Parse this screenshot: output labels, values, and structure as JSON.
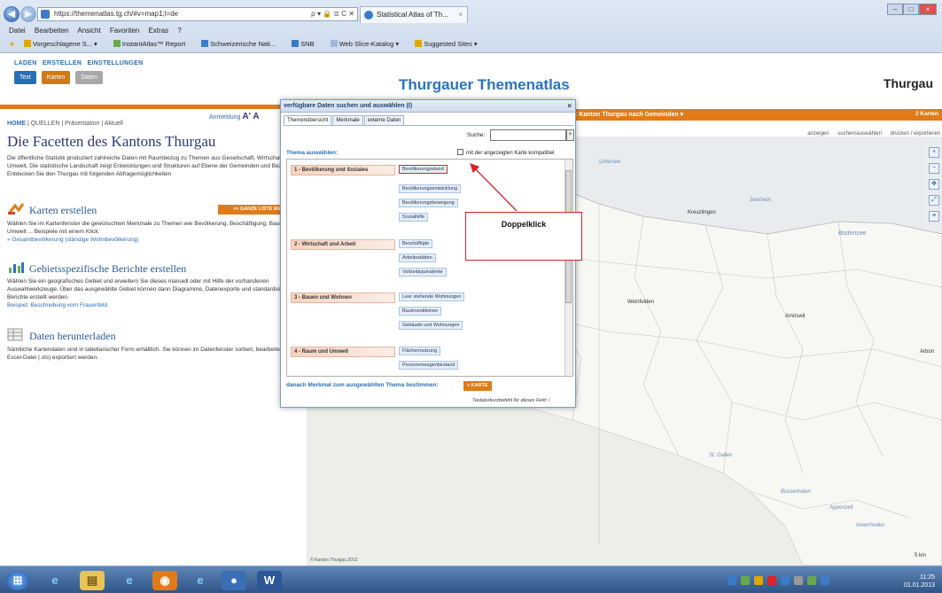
{
  "browser": {
    "url": "https://themenatlas.tg.ch/#v=map1;l=de",
    "address_tools": "ρ ▾ 🔒 ≣ C ✕",
    "tab_title": "Statistical Atlas of Th...",
    "menu": [
      "Datei",
      "Bearbeiten",
      "Ansicht",
      "Favoriten",
      "Extras",
      "?"
    ],
    "favorites": [
      "Vorgeschlagene S... ▾",
      "InstantAtlas™ Report",
      "Schweizerische Nati...",
      "SNB",
      "Web Slice-Katalog ▾",
      "Suggested Sites ▾"
    ]
  },
  "header": {
    "links": [
      "LADEN",
      "ERSTELLEN",
      "EINSTELLUNGEN"
    ],
    "mode_buttons": [
      "Text",
      "Karten",
      "Daten"
    ],
    "title": "Thurgauer Themenatlas",
    "brand": "Thurgau"
  },
  "left": {
    "login": "Anmeldung",
    "font_size": "A' A",
    "breadcrumb": [
      "HOME",
      "QUELLEN",
      "Präsentation",
      "Aktuell"
    ],
    "heading": "Die Facetten des Kantons Thurgau",
    "intro": "Die öffentliche Statistik produziert zahlreiche Daten mit Raumbezug zu Themen aus Gesellschaft, Wirtschaft und Umwelt. Die statistische Landschaft zeigt Entwicklungen und Strukturen auf Ebene der Gemeinden und Bezirke. Entdecken Sie den Thurgau mit folgenden Abfragemöglichkeiten",
    "sections": [
      {
        "title": "Karten erstellen",
        "text": "Wählen Sie im Kartenfenster die gewünschten Merkmale zu Themen wie Bevölkerung, Beschäftigung, Bauen, Umwelt ... Beispiele mit einem Klick:",
        "link": "» Gesamtbevölkerung (ständige Wohnbevölkerung)"
      },
      {
        "title": "Gebietsspezifische Berichte erstellen",
        "text": "Wählen Sie ein geografisches Gebiet und erweitern Sie dieses manuell oder mit Hilfe der vorhandenen Auswahlwerkzeuge. Über das ausgewählte Gebiet können dann Diagramme, Datenexporte und standardisierte Berichte erstellt werden.",
        "link": "Beispiel: Beschreibung vom Frauenfeld"
      },
      {
        "title": "Daten herunterladen",
        "text": "Sämtliche Kartendaten sind in tabellarischer Form erhältlich. Sie können im Datenfenster sortiert, bearbeitet und als Excel-Datei (.xls) exportiert werden.",
        "link": ""
      }
    ],
    "list_button": ">> GANZE LISTE MERK"
  },
  "map": {
    "title": ": Kanton Thurgau nach Gemeinden ▾",
    "right_label": "2 Karten",
    "toolbar": [
      "anzeigen",
      "suchen/auswählen",
      "drucken / exportieren"
    ],
    "labels": {
      "kreuzlingen": "Kreuzlingen",
      "bodensee": "Bodensee",
      "weinfelden": "Weinfelden",
      "amriswil": "Amriswil",
      "arbon": "Arbon",
      "st_gallen": "St. Gallen",
      "appenzell": "Appenzell",
      "untersee": "Untersee",
      "seerhein": "Seerhein",
      "bussertoden": "Bussertoden",
      "innerrhoden": "Innerrhoden"
    },
    "copyright": "© Kanton Thurgau 2012",
    "scale": "5 km"
  },
  "dialog": {
    "title": "verfügbare Daten suchen und auswählen (I)",
    "close": "×",
    "tabs": [
      "Themenübersicht",
      "Merkmale",
      "externe Daten"
    ],
    "search_label": "Suche:",
    "search_value": "",
    "search_clear": "×",
    "choose_label": "Thema auswählen:",
    "compat_label": "mit der angezeigten Karte kompatibel",
    "themes": [
      {
        "name": "1 - Bevölkerung und Soziales",
        "items": [
          "Bevölkerungsstand",
          "Bevölkerungsentwicklung",
          "Bevölkerungsbewegung",
          "Sozialhilfe"
        ]
      },
      {
        "name": "2 - Wirtschaft und Arbeit",
        "items": [
          "Beschäftigte",
          "Arbeitsstätten",
          "Vollzeitäquivalente"
        ]
      },
      {
        "name": "3 - Bauen und Wohnen",
        "items": [
          "Leer stehende Wohnungen",
          "Bauinvestitionen",
          "Gebäude und Wohnungen"
        ]
      },
      {
        "name": "4 - Raum und Umwelt",
        "items": [
          "Flächennutzung",
          "Personenwagenbestand"
        ]
      }
    ],
    "footer_label": "danach Merkmal zum ausgewählten Thema bestimmen:",
    "footer_button": "» KARTE",
    "keyboard_hint": "Tastaturkurzbefehl für dieses Feld: /"
  },
  "annotation": {
    "text": "Doppelklick"
  },
  "taskbar": {
    "time": "11:25",
    "date": "01.01.2013"
  },
  "colors": {
    "accent_orange": "#e07b1a",
    "title_blue": "#2a73c0",
    "annotation_red": "#d9242a"
  }
}
